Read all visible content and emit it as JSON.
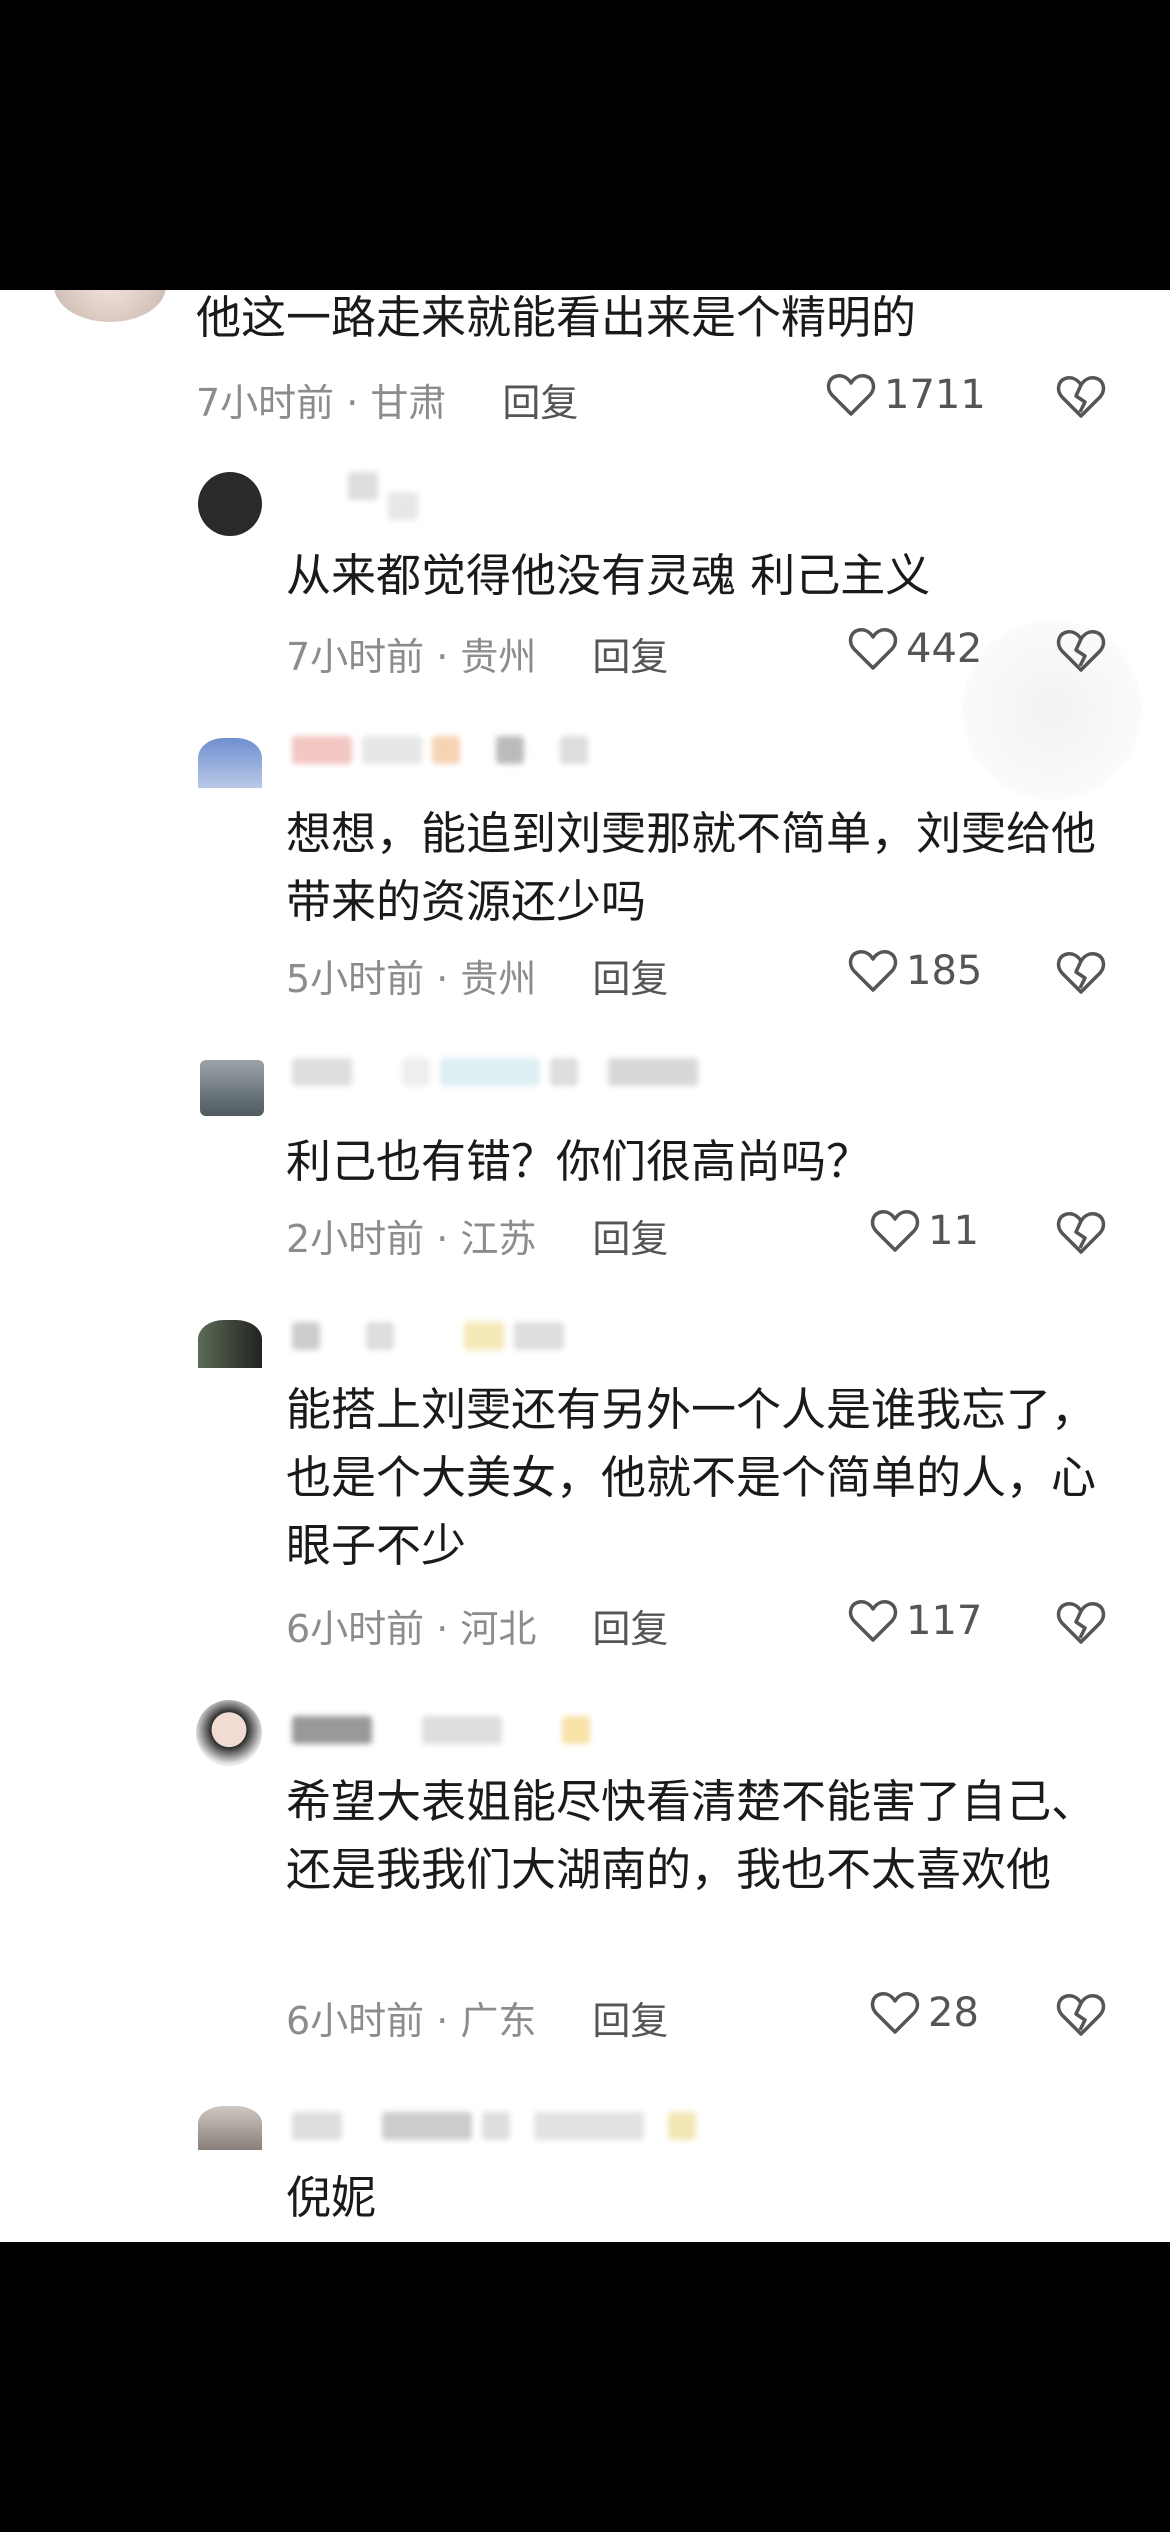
{
  "comments": [
    {
      "text": "他这一路走来就能看出来是个精明的",
      "time": "7小时前 · 甘肃",
      "reply": "回复",
      "likes": "1711"
    },
    {
      "text": "从来都觉得他没有灵魂 利己主义",
      "time": "7小时前 · 贵州",
      "reply": "回复",
      "likes": "442"
    },
    {
      "text": "想想，能追到刘雯那就不简单，刘雯给他带来的资源还少吗",
      "time": "5小时前 · 贵州",
      "reply": "回复",
      "likes": "185"
    },
    {
      "text": "利己也有错？你们很高尚吗？",
      "time": "2小时前 · 江苏",
      "reply": "回复",
      "likes": "11"
    },
    {
      "text": "能搭上刘雯还有另外一个人是谁我忘了，也是个大美女，他就不是个简单的人，心眼子不少",
      "time": "6小时前 · 河北",
      "reply": "回复",
      "likes": "117"
    },
    {
      "text": "希望大表姐能尽快看清楚不能害了自己、还是我我们大湖南的，我也不太喜欢他",
      "time": "6小时前 · 广东",
      "reply": "回复",
      "likes": "28"
    },
    {
      "text": "倪妮",
      "time": "",
      "reply": "",
      "likes": ""
    }
  ],
  "icons": {
    "like": "heart-outline-icon",
    "dislike": "broken-heart-icon"
  },
  "colors": {
    "background": "#ffffff",
    "text": "#1a1a1a",
    "meta": "#8c8c8c"
  }
}
